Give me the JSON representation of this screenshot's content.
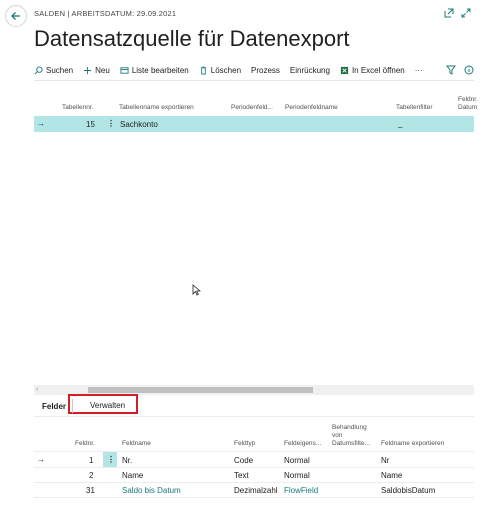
{
  "header": {
    "caption": "SALDEN | ARBEITSDATUM: 29.09.2021",
    "title": "Datensatzquelle für Datenexport"
  },
  "toolbar": {
    "suchen": "Suchen",
    "neu": "Neu",
    "liste_bearbeiten": "Liste bearbeiten",
    "loeschen": "Löschen",
    "prozess": "Prozess",
    "einrueckung": "Einrückung",
    "in_excel": "In Excel öffnen",
    "more": "···"
  },
  "main_table": {
    "columns": [
      "Tabellennr.",
      "Tabellenname exportieren",
      "Periodenfeld...",
      "Periodenfeldname",
      "Tabellenfilter",
      "Feldnr.",
      "Datum"
    ],
    "rows": [
      {
        "tabellennr": "15",
        "tabellenname": "Sachkonto",
        "tabellenfilter": "_"
      }
    ]
  },
  "subpage": {
    "tab_felder": "Felder",
    "tab_verwalten": "Verwalten",
    "columns": {
      "feldnr": "Feldnr.",
      "feldname": "Feldname",
      "feldtyp": "Feldtyp",
      "feldeigens": "Feldeigens...",
      "behandlung_1": "Behandlung",
      "behandlung_2": "von",
      "behandlung_3": "Datumsfilte...",
      "feldname_export": "Feldname exportieren"
    },
    "rows": [
      {
        "feldnr": "1",
        "feldname": "Nr.",
        "feldtyp": "Code",
        "feldeigens": "Normal",
        "export": "Nr"
      },
      {
        "feldnr": "2",
        "feldname": "Name",
        "feldtyp": "Text",
        "feldeigens": "Normal",
        "export": "Name"
      },
      {
        "feldnr": "31",
        "feldname": "Saldo bis Datum",
        "feldtyp": "Dezimalzahl",
        "feldeigens": "FlowField",
        "export": "SaldobisDatum"
      }
    ]
  },
  "colors": {
    "accent": "#1b7a7a",
    "selected_row": "#b2e6e6",
    "highlight_box": "#d2202a"
  }
}
